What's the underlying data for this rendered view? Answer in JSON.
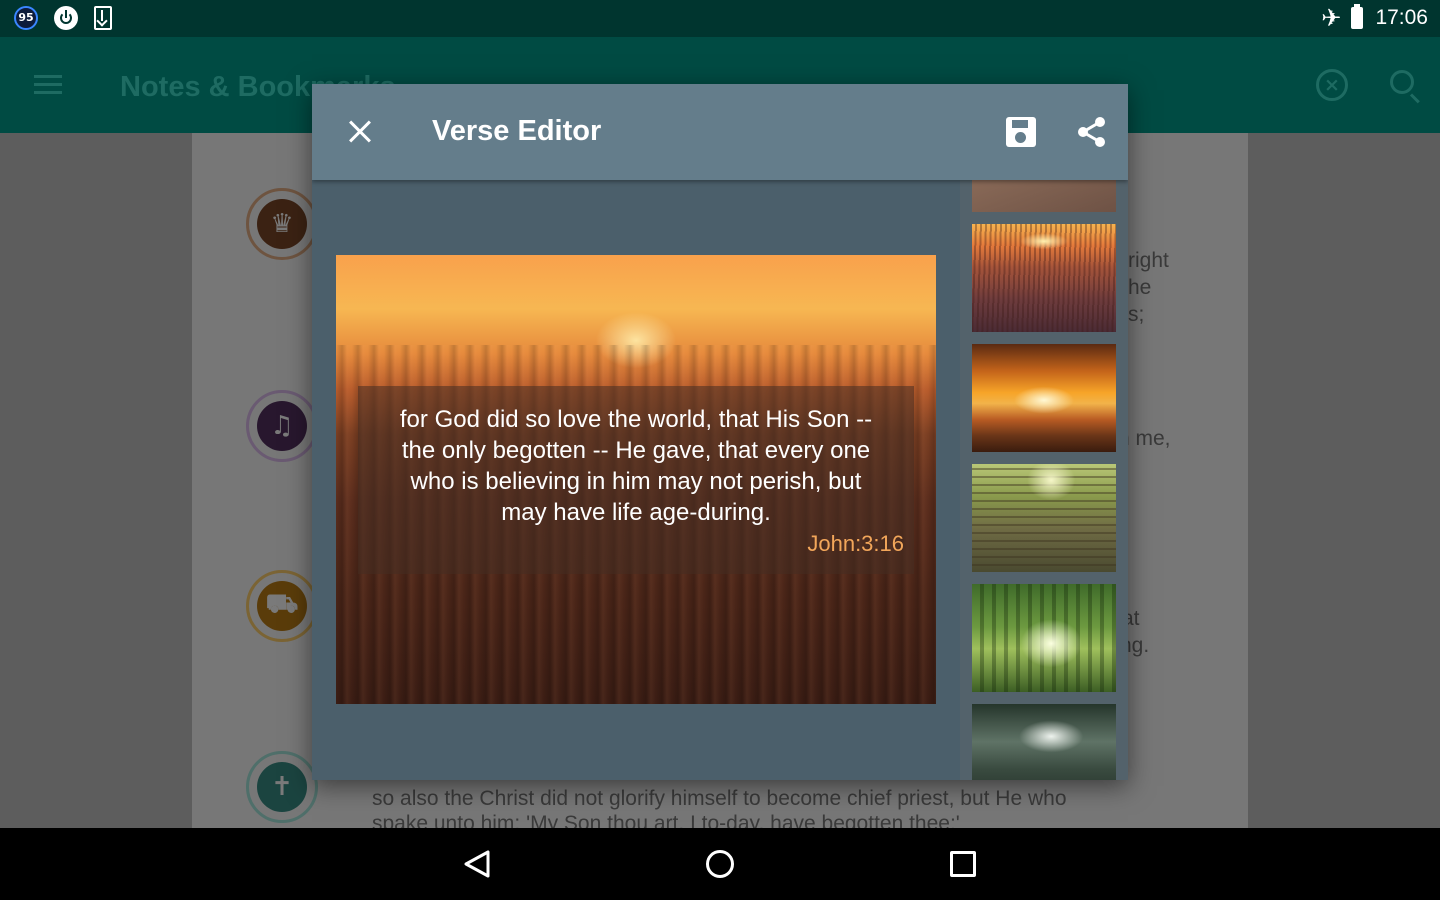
{
  "status_bar": {
    "badge": "95",
    "time": "17:06",
    "icons": [
      "notification-badge-icon",
      "power-icon",
      "download-icon",
      "airplane-icon",
      "battery-icon"
    ]
  },
  "app_bar": {
    "title": "Notes & Bookmarks",
    "icons": [
      "hamburger-icon",
      "clear-icon",
      "search-icon"
    ]
  },
  "background_list": {
    "snippets": [
      "right",
      "he",
      "s;",
      "n me,",
      "at",
      "ng."
    ],
    "bottom_line_1": "so also the Christ did not glorify himself to become chief  priest, but He who",
    "bottom_line_2": "spake unto him: 'My Son thou art, I to-day, have begotten thee;'"
  },
  "dialog": {
    "title": "Verse Editor",
    "verse_text": "for God did so love the world, that His Son --\nthe only  begotten -- He gave, that every one\nwho is believing in him  may not perish, but\nmay have life age-during.",
    "verse_reference": "John:3:16",
    "thumbnails": [
      "partial-image",
      "wheat-field-sunset",
      "sunset-above-clouds",
      "stone-steps-in-forest",
      "sunlight-through-forest",
      "light-rays-through-trees"
    ]
  },
  "colors": {
    "status_bar": "#00352f",
    "app_bar": "#004b43",
    "dialog_bar": "#647d8b",
    "dialog_body": "#4b5f6b",
    "verse_reference": "#f2a65a"
  }
}
